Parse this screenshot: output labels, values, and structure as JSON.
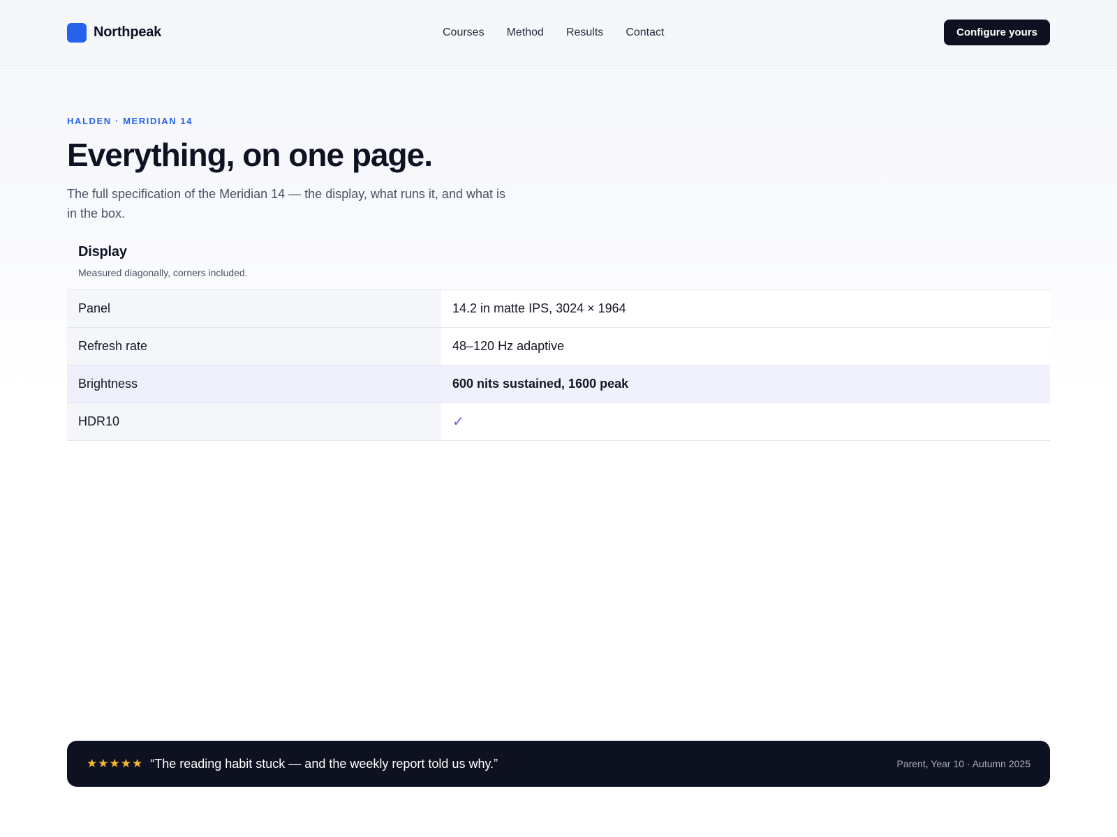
{
  "nav": {
    "brand": "Northpeak",
    "links": [
      "Courses",
      "Method",
      "Results",
      "Contact"
    ],
    "cta": "Configure yours",
    "accent": "#2563eb"
  },
  "hero": {
    "eyebrow": "HALDEN · MERIDIAN 14",
    "title": "Everything, on one page.",
    "lede": "The full specification of the Meridian 14 — the display, what runs it, and what is in the box."
  },
  "spec": {
    "title": "Display",
    "subtitle": "Measured diagonally, corners included.",
    "rows": [
      {
        "label": "Panel",
        "value": "14.2 in matte IPS, 3024 × 1964"
      },
      {
        "label": "Refresh rate",
        "value": "48–120 Hz adaptive"
      },
      {
        "label": "Brightness",
        "value": "600 nits sustained, 1600 peak",
        "highlight": true
      },
      {
        "label": "HDR10",
        "value": "✓",
        "icon": "check-icon"
      }
    ]
  },
  "banner": {
    "stars": "★★★★★",
    "quote": "“The reading habit stuck — and the weekly report told us why.”",
    "attribution": "Parent, Year 10 · Autumn 2025"
  }
}
